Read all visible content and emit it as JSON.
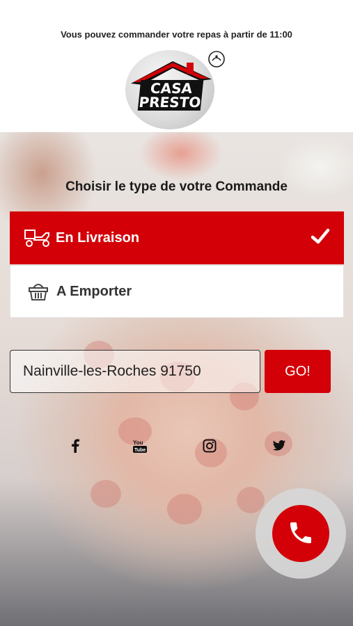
{
  "header": {
    "notice": "Vous pouvez commander votre repas à partir de 11:00",
    "logo": {
      "line1": "CASA",
      "line2": "PRESTO"
    }
  },
  "order_type": {
    "title": "Choisir le type de votre Commande",
    "options": [
      {
        "label": "En Livraison",
        "icon": "delivery-scooter-icon",
        "selected": true
      },
      {
        "label": "A Emporter",
        "icon": "basket-icon",
        "selected": false
      }
    ]
  },
  "address": {
    "value": "Nainville-les-Roches 91750",
    "go_label": "GO!"
  },
  "social": [
    "facebook-icon",
    "youtube-icon",
    "instagram-icon",
    "twitter-icon"
  ],
  "colors": {
    "brand_red": "#d30008",
    "text_dark": "#1a1a1a"
  }
}
